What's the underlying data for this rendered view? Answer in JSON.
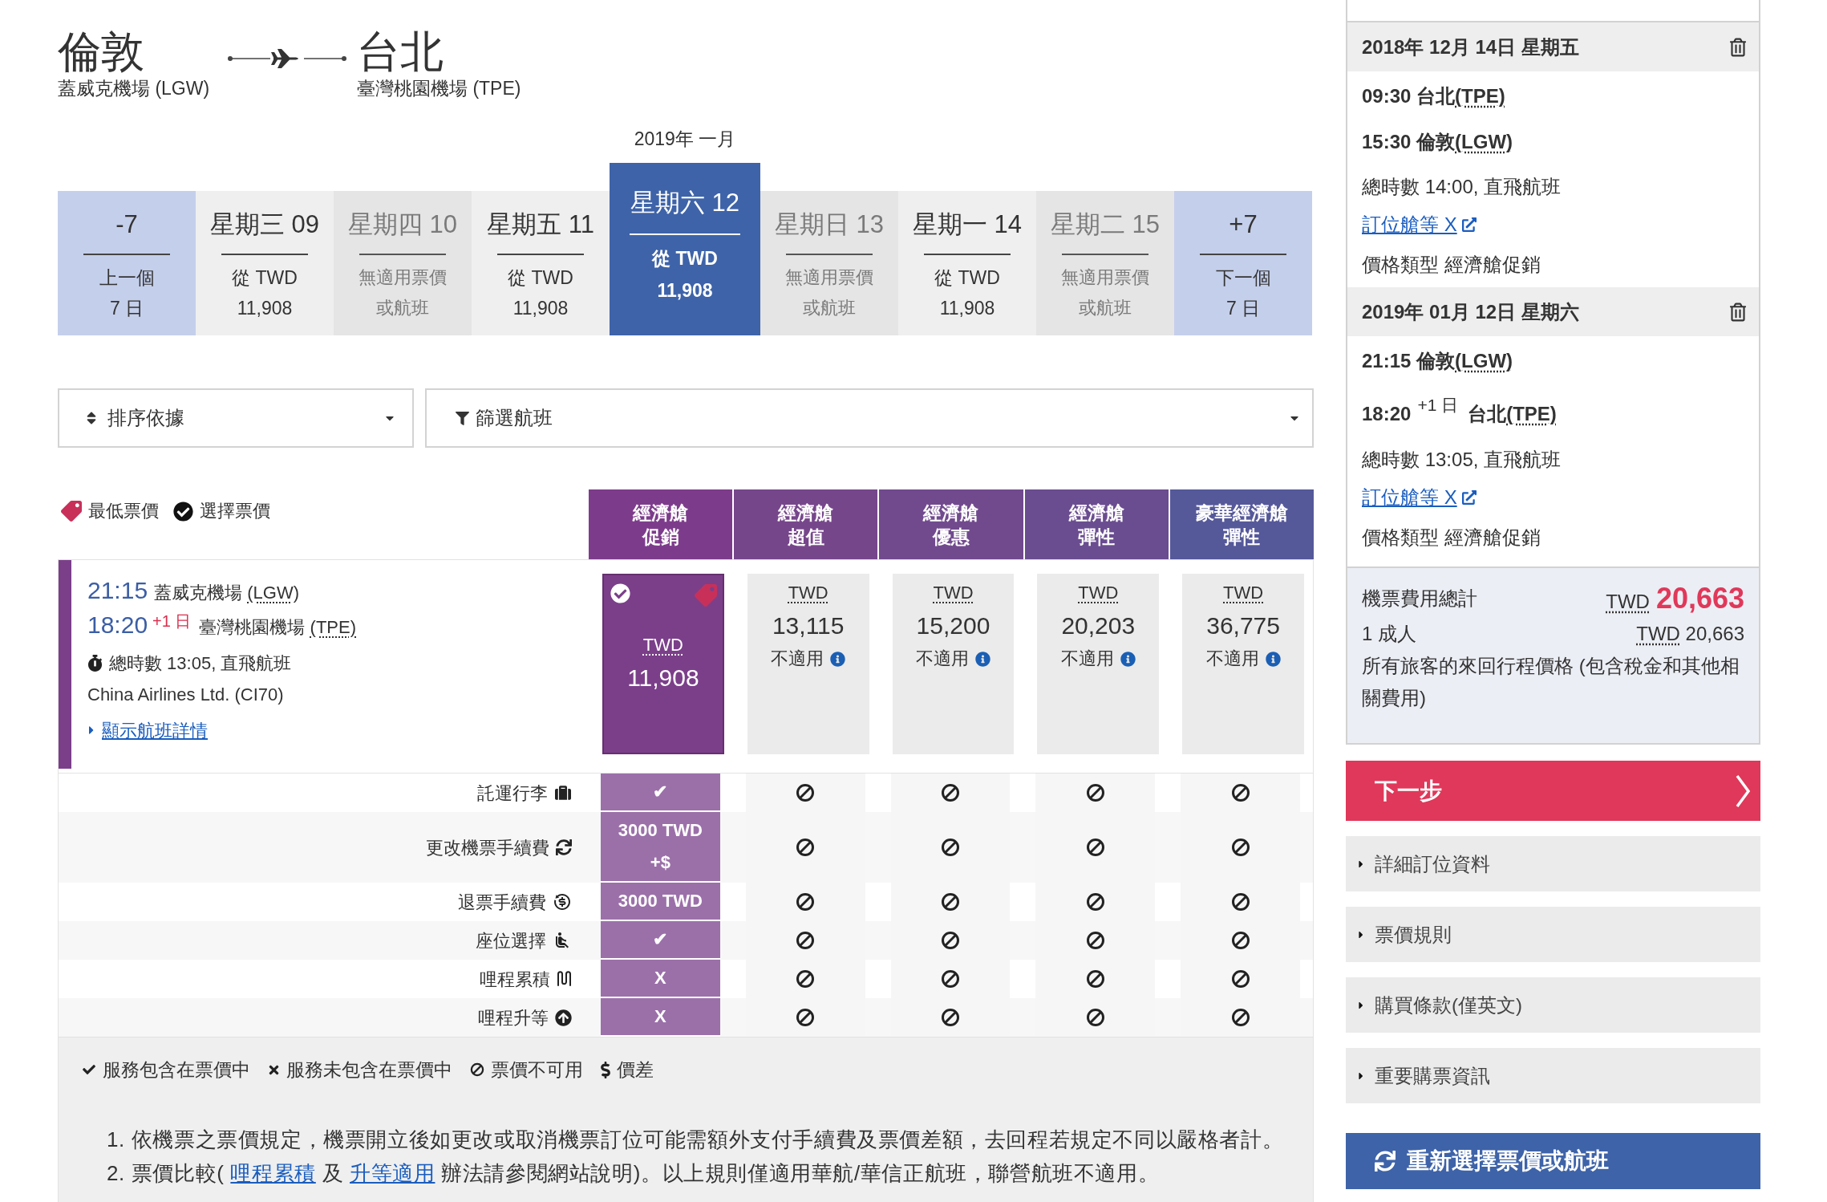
{
  "route": {
    "origin": {
      "city": "倫敦",
      "airport": "蓋威克機場 (LGW)"
    },
    "destination": {
      "city": "台北",
      "airport": "臺灣桃園機場 (TPE)"
    }
  },
  "date_strip": {
    "month": "2019年 一月",
    "tiles": [
      {
        "kind": "nav",
        "label": "-7",
        "line_1": "上一個",
        "line_2": "7 日"
      },
      {
        "kind": "day",
        "label": "星期三 09",
        "line_1": "從 TWD",
        "line_2": "11,908",
        "available": true,
        "selected": false
      },
      {
        "kind": "day",
        "label": "星期四 10",
        "line_1": "無適用票價",
        "line_2": "或航班",
        "available": false,
        "selected": false
      },
      {
        "kind": "day",
        "label": "星期五 11",
        "line_1": "從 TWD",
        "line_2": "11,908",
        "available": true,
        "selected": false
      },
      {
        "kind": "day",
        "label": "星期六 12",
        "line_1": "從 TWD",
        "line_2": "11,908",
        "available": true,
        "selected": true
      },
      {
        "kind": "day",
        "label": "星期日 13",
        "line_1": "無適用票價",
        "line_2": "或航班",
        "available": false,
        "selected": false
      },
      {
        "kind": "day",
        "label": "星期一 14",
        "line_1": "從 TWD",
        "line_2": "11,908",
        "available": true,
        "selected": false
      },
      {
        "kind": "day",
        "label": "星期二 15",
        "line_1": "無適用票價",
        "line_2": "或航班",
        "available": false,
        "selected": false
      },
      {
        "kind": "nav",
        "label": "+7",
        "line_1": "下一個",
        "line_2": "7 日"
      }
    ]
  },
  "sort": {
    "label": "排序依據"
  },
  "filter": {
    "label": "篩選航班"
  },
  "fare_legend": [
    {
      "kind": "lowest",
      "label": "最低票價"
    },
    {
      "kind": "selected",
      "label": "選擇票價"
    }
  ],
  "fare_columns": [
    {
      "line_1": "經濟艙",
      "line_2": "促銷",
      "color": "#7d3c8b"
    },
    {
      "line_1": "經濟艙",
      "line_2": "超值",
      "color": "#76468b"
    },
    {
      "line_1": "經濟艙",
      "line_2": "優惠",
      "color": "#714a8e"
    },
    {
      "line_1": "經濟艙",
      "line_2": "彈性",
      "color": "#6a4d90"
    },
    {
      "line_1": "豪華經濟艙",
      "line_2": "彈性",
      "color": "#555899"
    }
  ],
  "flight": {
    "departure": {
      "time": "21:15",
      "airport": "蓋威克機場",
      "code": "(LGW)"
    },
    "arrival": {
      "time": "18:20",
      "day_offset": "+1 日",
      "airport": "臺灣桃園機場",
      "code": "(TPE)"
    },
    "duration": "總時數 13:05, 直飛航班",
    "carrier": "China Airlines Ltd. (CI70)",
    "details_link": "顯示航班詳情",
    "fares": [
      {
        "currency": "TWD",
        "amount": "11,908",
        "selected": true,
        "lowest": true
      },
      {
        "currency": "TWD",
        "amount": "13,115",
        "note": "不適用",
        "selected": false,
        "lowest": false
      },
      {
        "currency": "TWD",
        "amount": "15,200",
        "note": "不適用",
        "selected": false,
        "lowest": false
      },
      {
        "currency": "TWD",
        "amount": "20,203",
        "note": "不適用",
        "selected": false,
        "lowest": false
      },
      {
        "currency": "TWD",
        "amount": "36,775",
        "note": "不適用",
        "selected": false,
        "lowest": false
      }
    ]
  },
  "features": [
    {
      "kind": "baggage",
      "label": "託運行李",
      "values": [
        {
          "kind": "text",
          "lines": [
            "✔"
          ]
        },
        {
          "kind": "unavailable"
        },
        {
          "kind": "unavailable"
        },
        {
          "kind": "unavailable"
        },
        {
          "kind": "unavailable"
        }
      ]
    },
    {
      "kind": "change",
      "label": "更改機票手續費",
      "values": [
        {
          "kind": "text",
          "lines": [
            "3000 TWD",
            "+$"
          ]
        },
        {
          "kind": "unavailable"
        },
        {
          "kind": "unavailable"
        },
        {
          "kind": "unavailable"
        },
        {
          "kind": "unavailable"
        }
      ]
    },
    {
      "kind": "refund",
      "label": "退票手續費",
      "values": [
        {
          "kind": "text",
          "lines": [
            "3000 TWD"
          ]
        },
        {
          "kind": "unavailable"
        },
        {
          "kind": "unavailable"
        },
        {
          "kind": "unavailable"
        },
        {
          "kind": "unavailable"
        }
      ]
    },
    {
      "kind": "seat",
      "label": "座位選擇",
      "values": [
        {
          "kind": "text",
          "lines": [
            "✔"
          ]
        },
        {
          "kind": "unavailable"
        },
        {
          "kind": "unavailable"
        },
        {
          "kind": "unavailable"
        },
        {
          "kind": "unavailable"
        }
      ]
    },
    {
      "kind": "miles",
      "label": "哩程累積",
      "values": [
        {
          "kind": "text",
          "lines": [
            "X"
          ]
        },
        {
          "kind": "unavailable"
        },
        {
          "kind": "unavailable"
        },
        {
          "kind": "unavailable"
        },
        {
          "kind": "unavailable"
        }
      ]
    },
    {
      "kind": "upgrade",
      "label": "哩程升等",
      "values": [
        {
          "kind": "text",
          "lines": [
            "X"
          ]
        },
        {
          "kind": "unavailable"
        },
        {
          "kind": "unavailable"
        },
        {
          "kind": "unavailable"
        },
        {
          "kind": "unavailable"
        }
      ]
    }
  ],
  "legend": [
    {
      "kind": "included",
      "label": "服務包含在票價中"
    },
    {
      "kind": "excluded",
      "label": "服務未包含在票價中"
    },
    {
      "kind": "unavailable",
      "label": "票價不可用"
    },
    {
      "kind": "difference",
      "label": "價差"
    }
  ],
  "notes": [
    {
      "number": "1.",
      "parts": [
        {
          "kind": "text",
          "text": "依機票之票價規定，機票開立後如更改或取消機票訂位可能需額外支付手續費及票價差額，去回程若規定不同以嚴格者計。"
        }
      ]
    },
    {
      "number": "2.",
      "parts": [
        {
          "kind": "text",
          "text": "票價比較( "
        },
        {
          "kind": "link",
          "text": "哩程累積"
        },
        {
          "kind": "text",
          "text": " 及 "
        },
        {
          "kind": "link",
          "text": "升等適用"
        },
        {
          "kind": "text",
          "text": " 辦法請參閱網站說明)。以上規則僅適用華航/華信正航班，聯營航班不適用。"
        }
      ]
    }
  ],
  "itinerary": {
    "segments": [
      {
        "date": "2018年 12月 14日 星期五",
        "departure": {
          "time": "09:30",
          "place": "台北",
          "code": "(TPE)"
        },
        "arrival": {
          "time": "15:30",
          "place": "倫敦",
          "code": "(LGW)"
        },
        "duration": "總時數 14:00, 直飛航班",
        "cabin_link": "訂位艙等 X",
        "fare_type": "價格類型 經濟艙促銷"
      },
      {
        "date": "2019年 01月 12日 星期六",
        "departure": {
          "time": "21:15",
          "place": "倫敦",
          "code": "(LGW)"
        },
        "arrival": {
          "time": "18:20",
          "day_offset": "+1 日",
          "place": "台北",
          "code": "(TPE)"
        },
        "duration": "總時數 13:05, 直飛航班",
        "cabin_link": "訂位艙等 X",
        "fare_type": "價格類型 經濟艙促銷"
      }
    ]
  },
  "summary": {
    "total_label": "機票費用總計",
    "total_currency": "TWD",
    "total_amount": "20,663",
    "passengers": "1 成人",
    "passenger_currency": "TWD",
    "passenger_amount": "20,663",
    "note": "所有旅客的來回行程價格 (包含稅金和其他相關費用)"
  },
  "next_button": "下一步",
  "sections": [
    {
      "label": "詳細訂位資料",
      "expanded": false
    },
    {
      "label": "票價規則",
      "expanded": false
    },
    {
      "label": "購買條款(僅英文)",
      "expanded": false
    },
    {
      "label": "重要購票資訊",
      "expanded": false
    }
  ],
  "reselect_button": "重新選擇票價或航班"
}
